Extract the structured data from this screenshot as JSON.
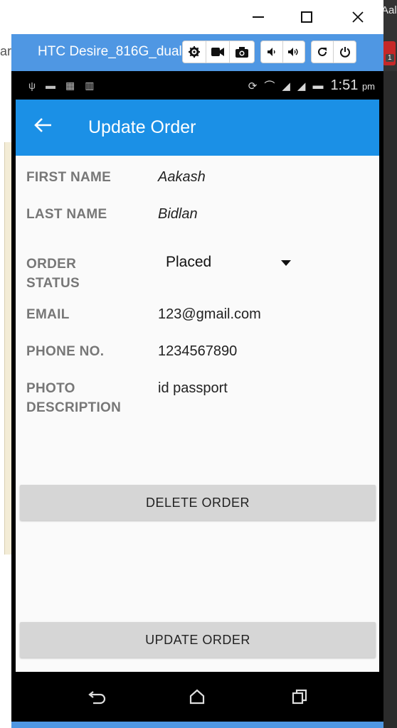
{
  "background": {
    "left_fragment": "ar",
    "right_fragment": "Aal",
    "right_badge": "1"
  },
  "window": {
    "controls": {
      "minimize_icon": "minimize-icon",
      "maximize_icon": "maximize-icon",
      "close_icon": "close-icon"
    }
  },
  "emulator": {
    "device_name": "HTC Desire_816G_dual",
    "accent": "#4f97e3",
    "buttons": [
      "gear-icon",
      "video-camera-icon",
      "camera-icon",
      "volume-down-icon",
      "volume-up-icon",
      "rotate-icon",
      "power-icon"
    ]
  },
  "status_bar": {
    "time": "1:51",
    "ampm": "pm"
  },
  "app_bar": {
    "title": "Update Order",
    "color": "#1b90e6"
  },
  "form": {
    "first_name_label": "FIRST NAME",
    "first_name_value": "Aakash",
    "last_name_label": "LAST NAME",
    "last_name_value": "Bidlan",
    "order_status_label_1": "ORDER",
    "order_status_label_2": "STATUS",
    "order_status_value": "Placed",
    "email_label": "EMAIL",
    "email_value": "123@gmail.com",
    "phone_label": "PHONE NO.",
    "phone_value": "1234567890",
    "photo_label_1": "PHOTO",
    "photo_label_2": "DESCRIPTION",
    "photo_value": "id passport"
  },
  "actions": {
    "delete_label": "DELETE ORDER",
    "update_label": "UPDATE ORDER"
  }
}
